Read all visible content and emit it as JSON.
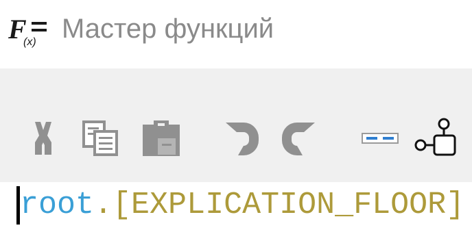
{
  "window": {
    "icon": "function-fx-icon",
    "title": "Мастер функций"
  },
  "toolbar": {
    "buttons": [
      {
        "name": "cut",
        "icon": "scissors-icon",
        "enabled": false
      },
      {
        "name": "copy",
        "icon": "copy-icon",
        "enabled": false
      },
      {
        "name": "paste",
        "icon": "clipboard-icon",
        "enabled": false
      },
      {
        "name": "undo",
        "icon": "undo-icon",
        "enabled": false
      },
      {
        "name": "redo",
        "icon": "redo-icon",
        "enabled": false
      },
      {
        "name": "insert-placeholder",
        "icon": "placeholder-icon",
        "enabled": true
      },
      {
        "name": "object-tree",
        "icon": "tree-icon",
        "enabled": true
      }
    ]
  },
  "editor": {
    "tokens": {
      "root": "root",
      "dot": ".",
      "field": "[EXPLICATION_FLOOR]"
    }
  },
  "colors": {
    "title_text": "#8a8a8a",
    "toolbar_bg": "#f0f0f0",
    "disabled_icon": "#909090",
    "token_root": "#3a9fd6",
    "token_field": "#ad9a3a",
    "placeholder_blue": "#2f7fd0"
  }
}
